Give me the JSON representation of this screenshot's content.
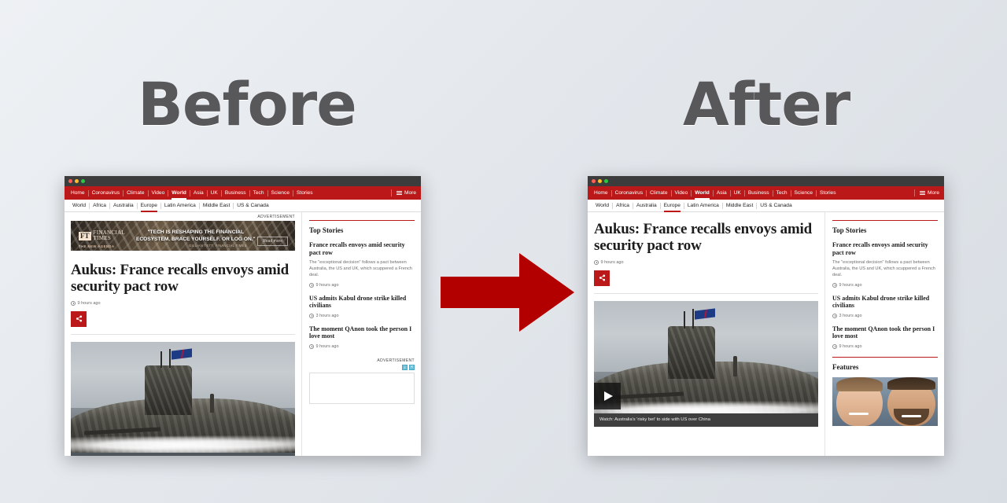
{
  "labels": {
    "before": "Before",
    "after": "After"
  },
  "arrow": {
    "name": "transformation-arrow",
    "color": "#b20000"
  },
  "background": {
    "color": "#e3e7ec"
  },
  "browser": {
    "topnav": {
      "items": [
        "Home",
        "Coronavirus",
        "Climate",
        "Video",
        "World",
        "Asia",
        "UK",
        "Business",
        "Tech",
        "Science",
        "Stories"
      ],
      "active": "World",
      "more_label": "More",
      "bar_color": "#bb1919"
    },
    "subnav": {
      "items": [
        "World",
        "Africa",
        "Australia",
        "Europe",
        "Latin America",
        "Middle East",
        "US & Canada"
      ],
      "active": "Europe"
    }
  },
  "article": {
    "headline": "Aukus: France recalls envoys amid security pact row",
    "timestamp": "9 hours ago",
    "share_label": "share-icon",
    "media_caption": "Watch: Australia's 'risky bet' to side with US over China"
  },
  "advertisement": {
    "label": "ADVERTISEMENT",
    "brand_mark": "FT",
    "brand_name_line1": "FINANCIAL",
    "brand_name_line2": "TIMES",
    "brand_tagline": "THE NEW AGENDA",
    "copy_line1": "\"TECH IS RESHAPING THE  FINANCIAL",
    "copy_line2": "ECOSYSTEM. BRACE YOURSELF. OR LOG ON.\"",
    "byline": "GILLIAN TETT, FINANCIAL TIMES",
    "cta": "Read more"
  },
  "advertisement2": {
    "label": "ADVERTISEMENT",
    "icon_info": "i",
    "icon_close": "✕"
  },
  "sidebar": {
    "top_stories_title": "Top Stories",
    "features_title": "Features",
    "stories": [
      {
        "title": "France recalls envoys amid security pact row",
        "summary": "The \"exceptional decision\" follows a pact between Australia, the US and UK, which scuppered a French deal.",
        "timestamp": "9 hours ago"
      },
      {
        "title": "US admits Kabul drone strike killed civilians",
        "summary": "",
        "timestamp": "3 hours ago"
      },
      {
        "title": "The moment QAnon took the person I love most",
        "summary": "",
        "timestamp": "9 hours ago"
      }
    ]
  }
}
